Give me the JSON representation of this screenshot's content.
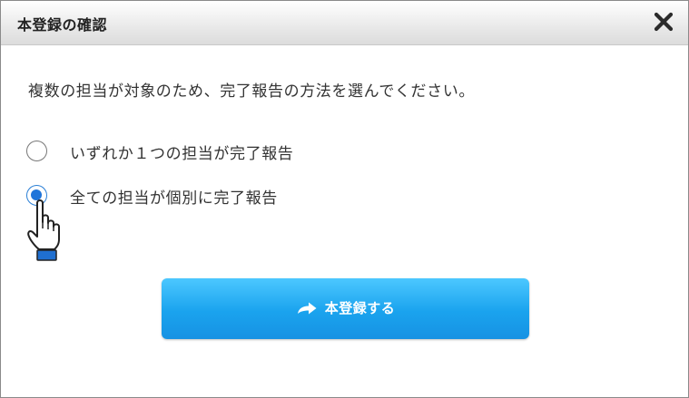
{
  "dialog": {
    "title": "本登録の確認",
    "message": "複数の担当が対象のため、完了報告の方法を選んでください。",
    "options": [
      {
        "label": "いずれか１つの担当が完了報告",
        "checked": false
      },
      {
        "label": "全ての担当が個別に完了報告",
        "checked": true
      }
    ],
    "submit_label": "本登録する",
    "icons": {
      "close": "close-icon",
      "submit": "arrow-right-icon",
      "pointer": "pointing-hand-icon"
    },
    "colors": {
      "accent": "#1f74d9",
      "button": "#1aa3ee"
    }
  }
}
